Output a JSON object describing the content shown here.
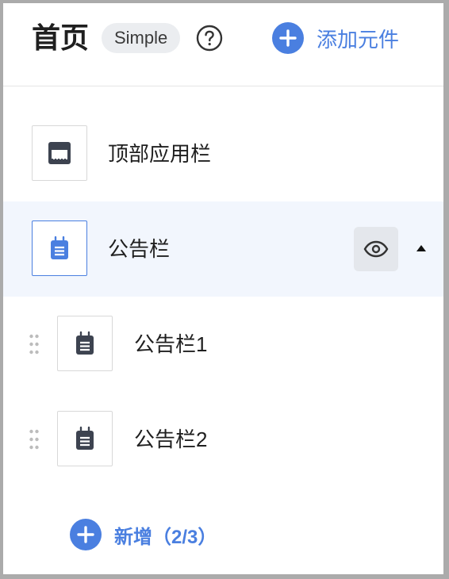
{
  "header": {
    "title": "首页",
    "badge": "Simple",
    "help_icon": "question-circle-icon",
    "add_label": "添加元件"
  },
  "components": [
    {
      "label": "顶部应用栏",
      "icon": "app-bar-icon"
    },
    {
      "label": "公告栏",
      "icon": "notice-board-icon",
      "selected": true,
      "expanded": true
    }
  ],
  "children": [
    {
      "label": "公告栏1",
      "icon": "notice-board-icon"
    },
    {
      "label": "公告栏2",
      "icon": "notice-board-icon"
    }
  ],
  "add_child_label": "新增（2/3）",
  "colors": {
    "accent": "#4a7fe0",
    "selected_bg": "#f2f6fd",
    "icon_dark": "#3d4350"
  }
}
